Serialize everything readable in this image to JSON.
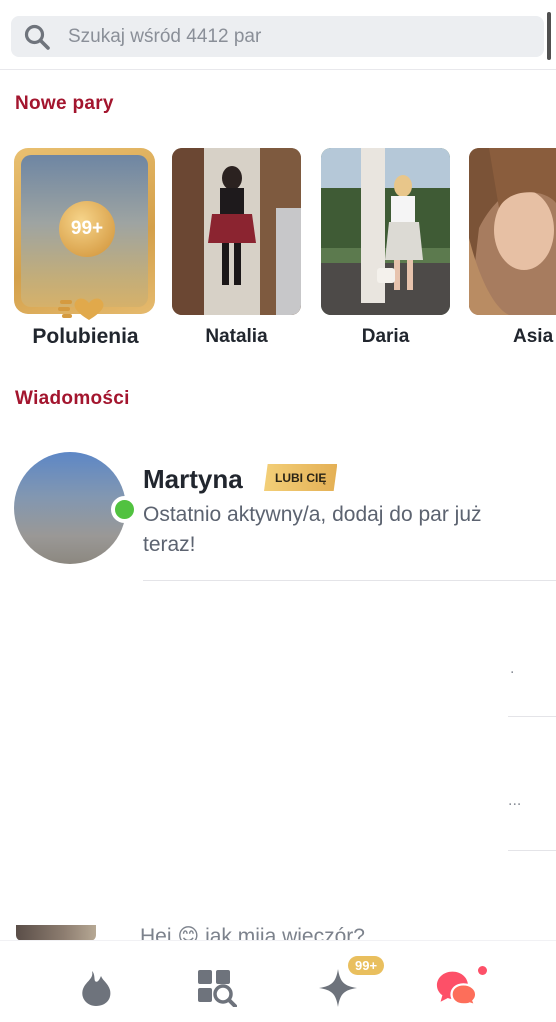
{
  "search": {
    "placeholder": "Szukaj wśród 4412 par"
  },
  "sections": {
    "new_matches_title": "Nowe pary",
    "messages_title": "Wiadomości"
  },
  "likes": {
    "count": "99+",
    "label": "Polubienia"
  },
  "new_matches": [
    {
      "name": "Natalia"
    },
    {
      "name": "Daria"
    },
    {
      "name": "Asia"
    }
  ],
  "messages": [
    {
      "name": "Martyna",
      "badge": "LUBI CIĘ",
      "preview": "Ostatnio aktywny/a, dodaj do par już teraz!",
      "online": true
    }
  ],
  "peek_message": {
    "preview": "Hej 😊 jak mija wieczór?"
  },
  "bottom_nav": {
    "items": [
      {
        "icon": "flame-icon"
      },
      {
        "icon": "explore-grid-icon"
      },
      {
        "icon": "sparkle-icon",
        "badge": "99+"
      },
      {
        "icon": "chat-bubbles-icon",
        "active": true
      }
    ]
  },
  "colors": {
    "accent": "#a3152e",
    "gold": "#e4b055",
    "online": "#51c240",
    "active_nav": "#fd5068"
  }
}
